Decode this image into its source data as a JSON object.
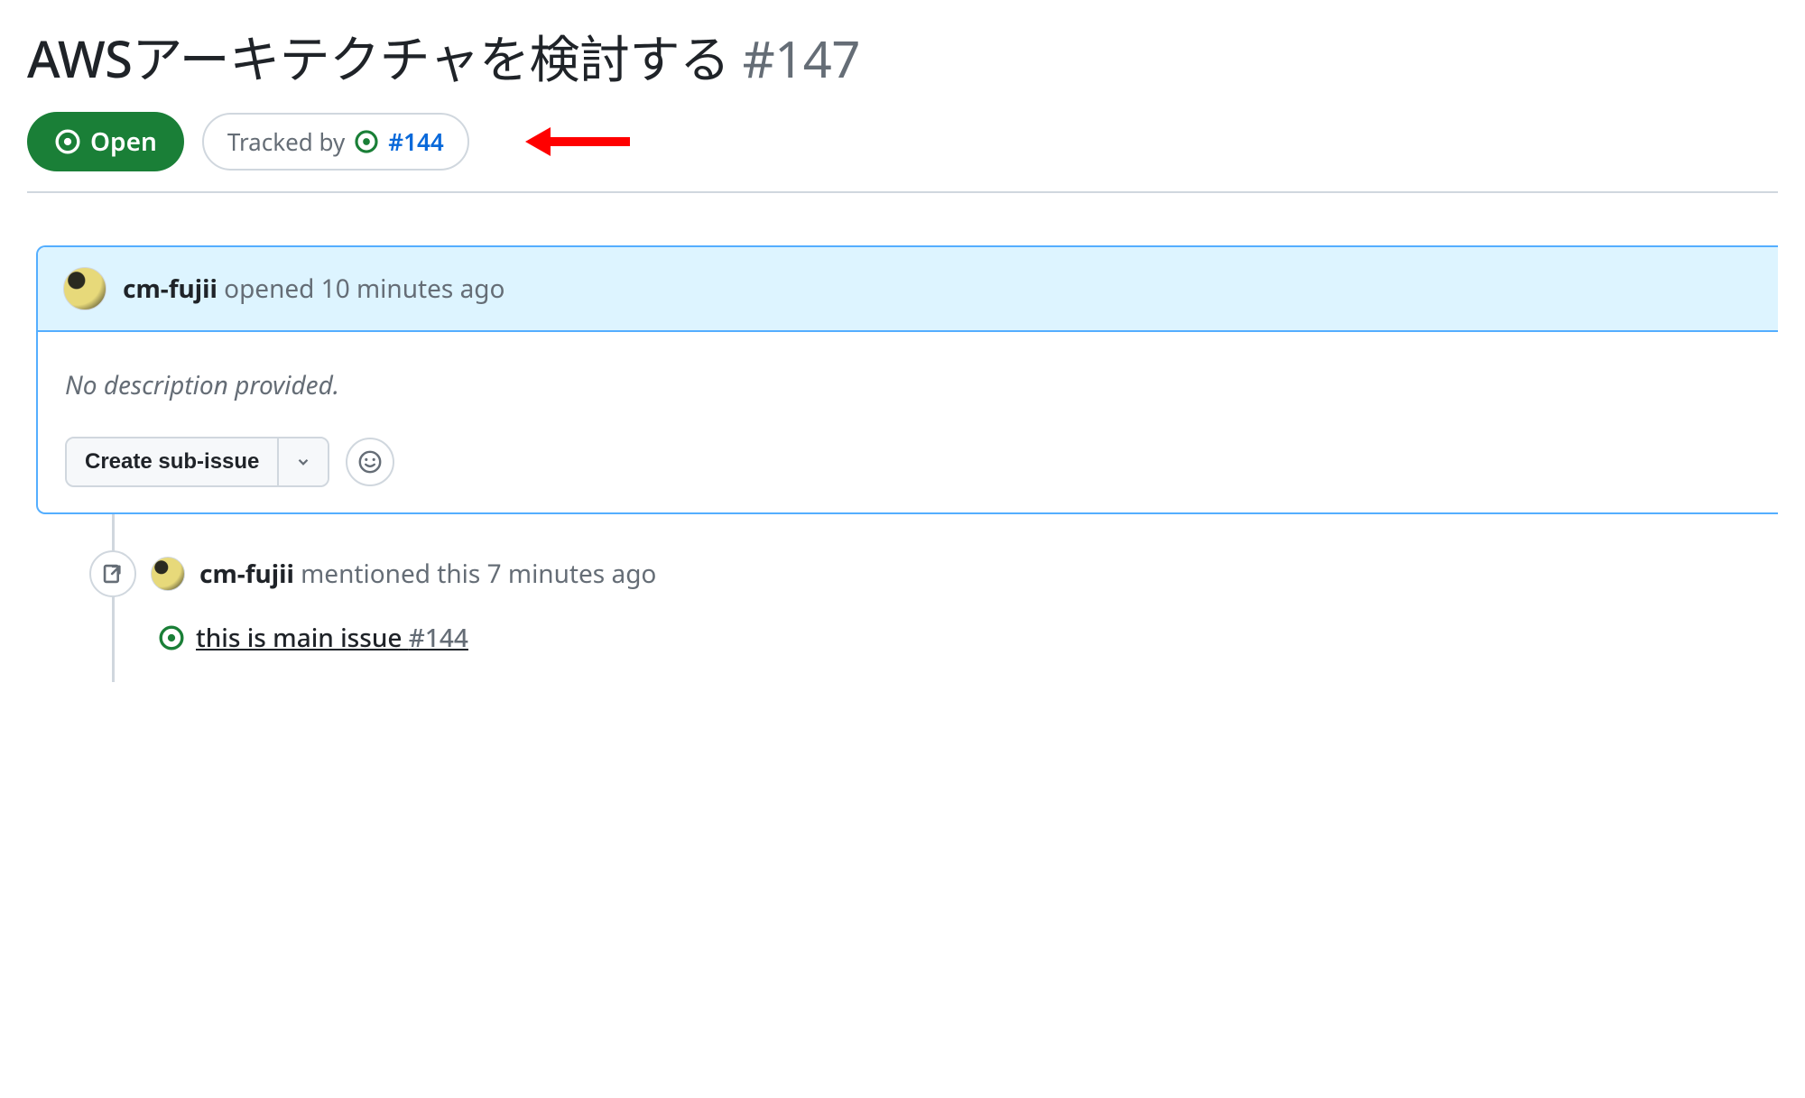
{
  "issue": {
    "title": "AWSアーキテクチャを検討する",
    "number": "#147"
  },
  "status": {
    "state_label": "Open",
    "tracked_by_label": "Tracked by",
    "tracked_by_issue": "#144"
  },
  "comment": {
    "author": "cm-fujii",
    "opened_text": "opened 10 minutes ago",
    "body": "No description provided.",
    "create_sub_issue_label": "Create sub-issue"
  },
  "timeline": {
    "mention": {
      "author": "cm-fujii",
      "text": "mentioned this 7 minutes ago",
      "ref_title": "this is main issue",
      "ref_number": "#144"
    }
  }
}
